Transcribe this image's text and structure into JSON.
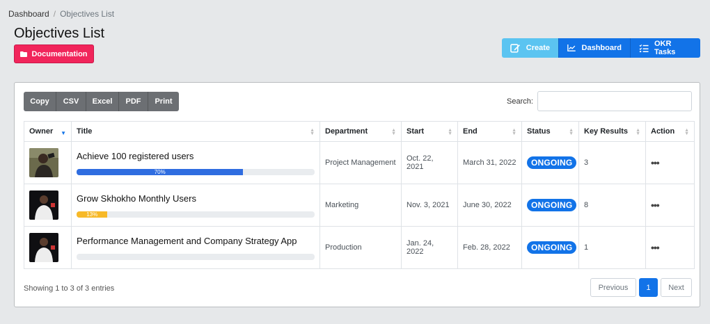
{
  "breadcrumb": {
    "root": "Dashboard",
    "separator": "/",
    "current": "Objectives List"
  },
  "page": {
    "title": "Objectives List",
    "documentation_label": "Documentation"
  },
  "actions": {
    "create": "Create",
    "dashboard": "Dashboard",
    "okr_tasks": "OKR Tasks"
  },
  "export": [
    "Copy",
    "CSV",
    "Excel",
    "PDF",
    "Print"
  ],
  "search": {
    "label": "Search:",
    "value": ""
  },
  "table": {
    "columns": [
      "Owner",
      "Title",
      "Department",
      "Start",
      "End",
      "Status",
      "Key Results",
      "Action"
    ],
    "rows": [
      {
        "title": "Achieve 100 registered users",
        "progress": 70,
        "progress_label": "70%",
        "department": "Project Management",
        "start": "Oct. 22, 2021",
        "end": "March 31, 2022",
        "status": "ONGOING",
        "key_results": "3",
        "action": "•••"
      },
      {
        "title": "Grow Skhokho Monthly Users",
        "progress": 13,
        "progress_label": "13%",
        "department": "Marketing",
        "start": "Nov. 3, 2021",
        "end": "June 30, 2022",
        "status": "ONGOING",
        "key_results": "8",
        "action": "•••"
      },
      {
        "title": "Performance Management and Company Strategy App",
        "progress": 0,
        "progress_label": "",
        "department": "Production",
        "start": "Jan. 24, 2022",
        "end": "Feb. 28, 2022",
        "status": "ONGOING",
        "key_results": "1",
        "action": "•••"
      }
    ]
  },
  "footer": {
    "info": "Showing 1 to 3 of 3 entries",
    "previous": "Previous",
    "current_page": "1",
    "next": "Next"
  },
  "colors": {
    "primary": "#1273e8",
    "create": "#5bc4f1",
    "documentation": "#f1255b",
    "progress_blue": "#2f6de0",
    "progress_yellow": "#f7b928"
  },
  "icons": {
    "documentation": "folder-icon",
    "create": "edit-icon",
    "dashboard": "chart-icon",
    "okr_tasks": "task-list-icon",
    "sort": "sort-icon"
  }
}
